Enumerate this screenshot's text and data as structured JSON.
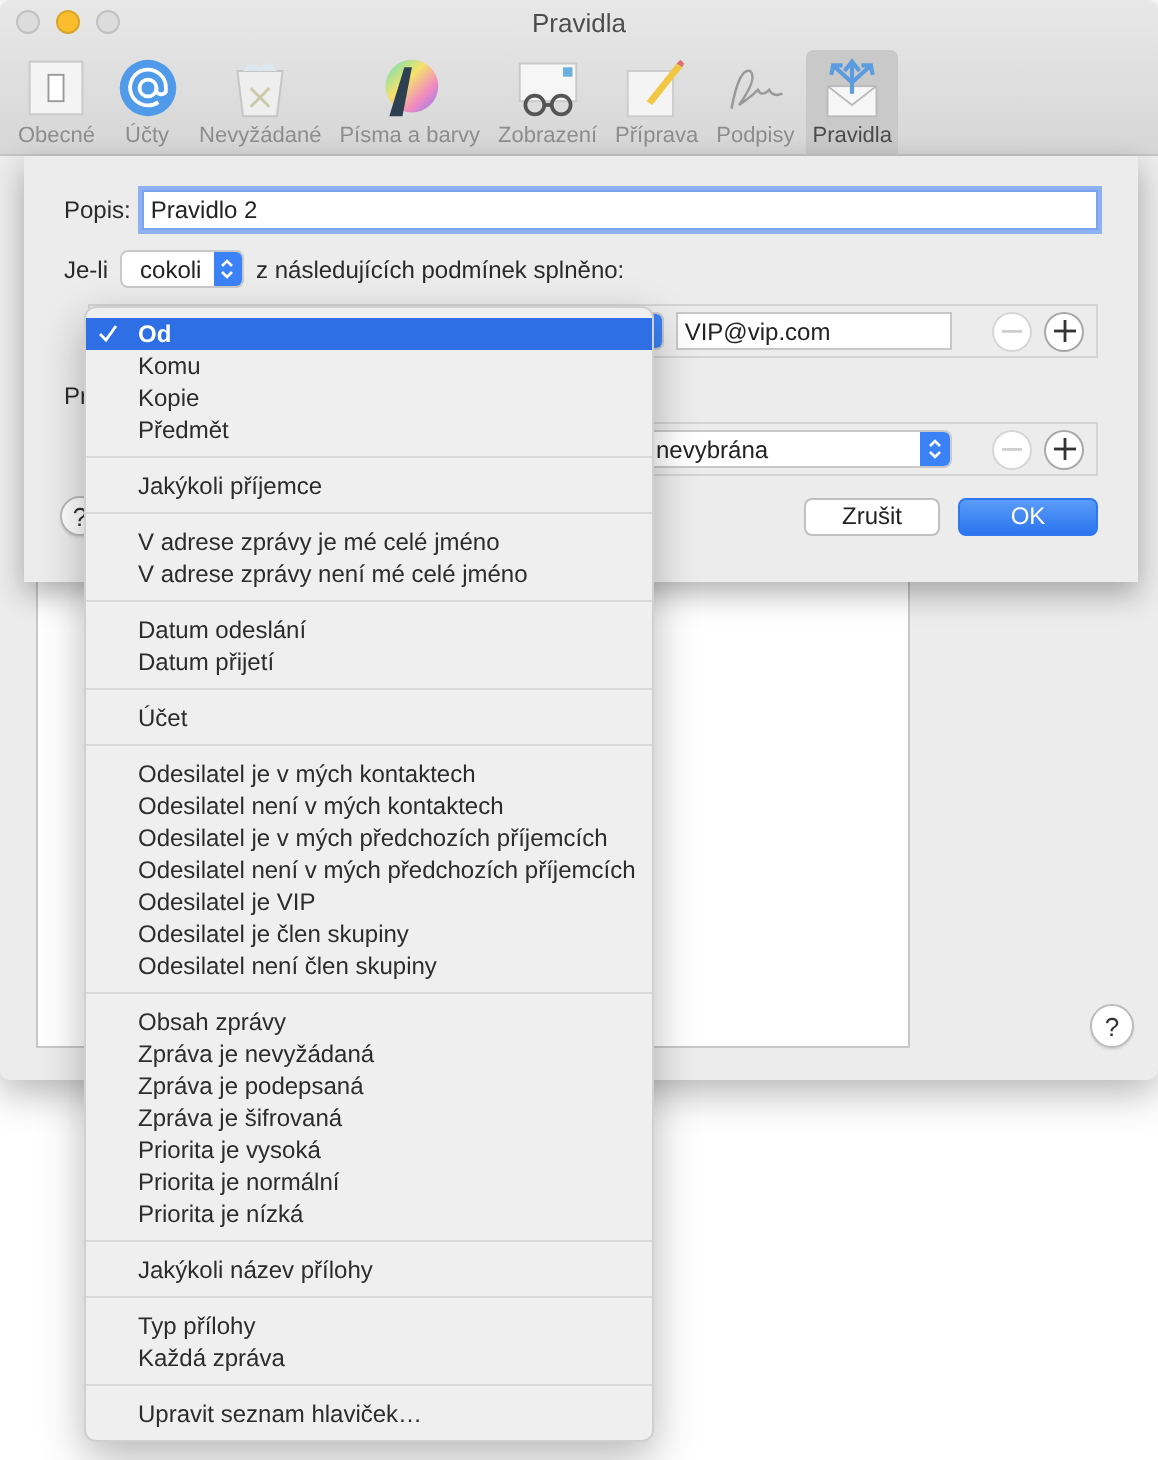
{
  "window": {
    "title": "Pravidla"
  },
  "toolbar": [
    {
      "label": "Obecné",
      "kind": "general",
      "selected": false
    },
    {
      "label": "Účty",
      "kind": "accounts",
      "selected": false
    },
    {
      "label": "Nevyžádané",
      "kind": "junk",
      "selected": false
    },
    {
      "label": "Písma a barvy",
      "kind": "fonts",
      "selected": false
    },
    {
      "label": "Zobrazení",
      "kind": "viewing",
      "selected": false
    },
    {
      "label": "Příprava",
      "kind": "composing",
      "selected": false
    },
    {
      "label": "Podpisy",
      "kind": "signatures",
      "selected": false
    },
    {
      "label": "Pravidla",
      "kind": "rules",
      "selected": true
    }
  ],
  "sheet": {
    "description_label": "Popis:",
    "description_value": "Pravidlo 2",
    "match_prefix": "Je-li",
    "match_value": "cokoli",
    "match_suffix": "z následujících podmínek splněno:",
    "conditions": [
      {
        "value": "VIP@vip.com",
        "remove_disabled": true
      }
    ],
    "actions_label": "Pr",
    "actions": [
      {
        "value": "nevybrána",
        "remove_disabled": true
      }
    ],
    "help": "?",
    "cancel": "Zrušit",
    "ok": "OK"
  },
  "menu": {
    "groups": [
      [
        {
          "label": "Od",
          "selected": true
        },
        {
          "label": "Komu",
          "selected": false
        },
        {
          "label": "Kopie",
          "selected": false
        },
        {
          "label": "Předmět",
          "selected": false
        }
      ],
      [
        {
          "label": "Jakýkoli příjemce",
          "selected": false
        }
      ],
      [
        {
          "label": "V adrese zprávy je mé celé jméno",
          "selected": false
        },
        {
          "label": "V adrese zprávy není mé celé jméno",
          "selected": false
        }
      ],
      [
        {
          "label": "Datum odeslání",
          "selected": false
        },
        {
          "label": "Datum přijetí",
          "selected": false
        }
      ],
      [
        {
          "label": "Účet",
          "selected": false
        }
      ],
      [
        {
          "label": "Odesilatel je v mých kontaktech",
          "selected": false
        },
        {
          "label": "Odesilatel není v mých kontaktech",
          "selected": false
        },
        {
          "label": "Odesilatel je v mých předchozích příjemcích",
          "selected": false
        },
        {
          "label": "Odesilatel není v mých předchozích příjemcích",
          "selected": false
        },
        {
          "label": "Odesilatel je VIP",
          "selected": false
        },
        {
          "label": "Odesilatel je člen skupiny",
          "selected": false
        },
        {
          "label": "Odesilatel není člen skupiny",
          "selected": false
        }
      ],
      [
        {
          "label": "Obsah zprávy",
          "selected": false
        },
        {
          "label": "Zpráva je nevyžádaná",
          "selected": false
        },
        {
          "label": "Zpráva je podepsaná",
          "selected": false
        },
        {
          "label": "Zpráva je šifrovaná",
          "selected": false
        },
        {
          "label": "Priorita je vysoká",
          "selected": false
        },
        {
          "label": "Priorita je normální",
          "selected": false
        },
        {
          "label": "Priorita je nízká",
          "selected": false
        }
      ],
      [
        {
          "label": "Jakýkoli název přílohy",
          "selected": false
        }
      ],
      [
        {
          "label": "Typ přílohy",
          "selected": false
        },
        {
          "label": "Každá zpráva",
          "selected": false
        }
      ],
      [
        {
          "label": "Upravit seznam hlaviček…",
          "selected": false
        }
      ]
    ]
  },
  "help": "?"
}
